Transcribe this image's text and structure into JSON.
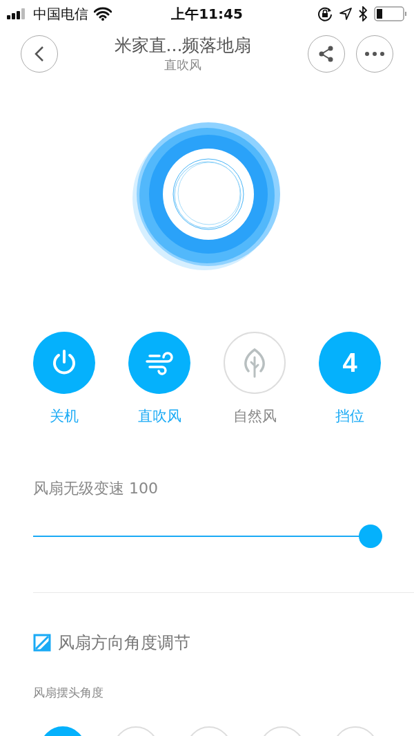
{
  "status_bar": {
    "carrier": "中国电信",
    "time": "上午11:45"
  },
  "header": {
    "title": "米家直...频落地扇",
    "subtitle": "直吹风"
  },
  "modes": [
    {
      "kind": "power",
      "label": "关机",
      "active": true
    },
    {
      "kind": "wind",
      "label": "直吹风",
      "active": true
    },
    {
      "kind": "leaf",
      "label": "自然风",
      "active": false
    },
    {
      "kind": "text",
      "text": "4",
      "label": "挡位",
      "active": true
    }
  ],
  "speed": {
    "label": "风扇无级变速 100",
    "level": 1
  },
  "direction": {
    "title": "风扇方向角度调节",
    "subtitle": "风扇摆头角度",
    "options": [
      {
        "selected": true
      },
      {
        "selected": false
      },
      {
        "selected": false
      },
      {
        "selected": false
      },
      {
        "selected": false
      }
    ]
  }
}
